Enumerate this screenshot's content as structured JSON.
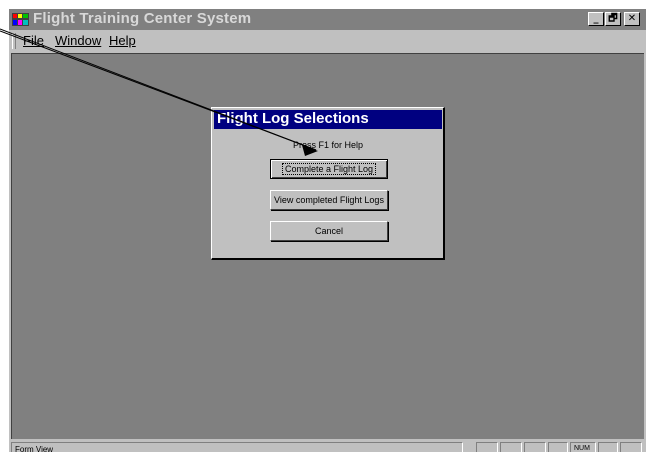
{
  "window": {
    "title": "Flight Training Center System",
    "controls": {
      "minimize": "_",
      "restore": "🗗",
      "close": "✕"
    },
    "icon": "app-icon"
  },
  "menu": [
    {
      "label": "File"
    },
    {
      "label": "Window"
    },
    {
      "label": "Help"
    }
  ],
  "dialog": {
    "title": "Flight Log Selections",
    "help_text": "Press F1 for Help",
    "buttons": [
      {
        "label": "Complete a Flight Log"
      },
      {
        "label": "View completed Flight Logs"
      },
      {
        "label": "Cancel"
      }
    ]
  },
  "statusbar": {
    "text": "Form View",
    "num": "NUM"
  },
  "colors": {
    "desktop": "#808080",
    "dialog_title": "#000080",
    "chrome": "#c0c0c0"
  }
}
